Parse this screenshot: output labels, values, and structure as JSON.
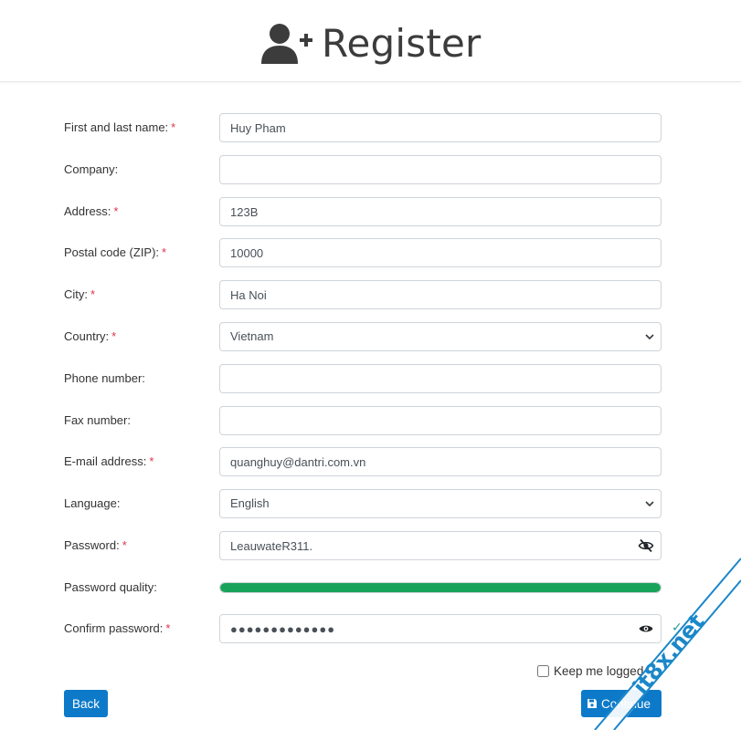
{
  "header": {
    "title": "Register",
    "icon": "user-plus-icon"
  },
  "form": {
    "fields": {
      "name": {
        "label": "First and last name:",
        "required": "*",
        "value": "Huy Pham"
      },
      "company": {
        "label": "Company:",
        "value": ""
      },
      "address": {
        "label": "Address:",
        "required": "*",
        "value": "123B"
      },
      "zip": {
        "label": "Postal code (ZIP):",
        "required": "*",
        "value": "10000"
      },
      "city": {
        "label": "City:",
        "required": "*",
        "value": "Ha Noi"
      },
      "country": {
        "label": "Country:",
        "required": "*",
        "value": "Vietnam"
      },
      "phone": {
        "label": "Phone number:",
        "value": ""
      },
      "fax": {
        "label": "Fax number:",
        "value": ""
      },
      "email": {
        "label": "E-mail address:",
        "required": "*",
        "value": "quanghuy@dantri.com.vn"
      },
      "language": {
        "label": "Language:",
        "value": "English"
      },
      "password": {
        "label": "Password:",
        "required": "*",
        "value": "LeauwateR311."
      },
      "quality": {
        "label": "Password quality:",
        "level_percent": 100,
        "color": "#19a35a"
      },
      "confirm": {
        "label": "Confirm password:",
        "required": "*",
        "value": "●●●●●●●●●●●●●",
        "check": "✓"
      }
    },
    "keep_logged_in": {
      "label": "Keep me logged in",
      "checked": false
    },
    "buttons": {
      "back": "Back",
      "continue": "Continue"
    }
  },
  "watermark": {
    "text": "it8x.net"
  },
  "colors": {
    "primary": "#0d7ac9",
    "required": "#dc3545",
    "success": "#19a35a"
  }
}
